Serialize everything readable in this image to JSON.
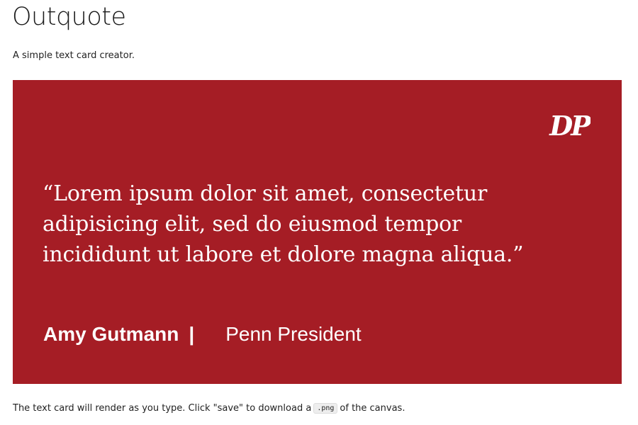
{
  "app": {
    "title": "Outquote",
    "subtitle": "A simple text card creator."
  },
  "card": {
    "background_color": "#a51d25",
    "text_color": "#ffffff",
    "logo_icon": "daily-pennsylvanian-dp-logo",
    "logo_text": "DP",
    "quote": "“Lorem ipsum dolor sit amet, consectetur adipisicing elit, sed do eiusmod tempor incididunt ut labore et dolore magna aliqua.”",
    "speaker_name": "Amy Gutmann",
    "separator": "|",
    "speaker_title": "Penn President"
  },
  "footer": {
    "note_before": "The text card will render as you type. Click \"save\" to download a",
    "code": ".png",
    "note_after": "of the canvas."
  }
}
